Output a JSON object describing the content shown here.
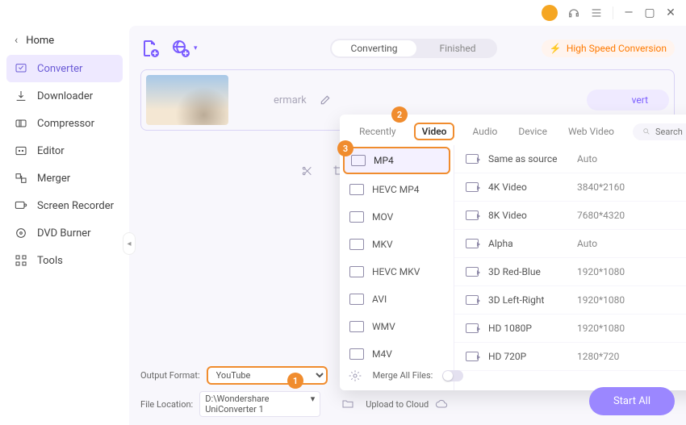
{
  "titlebar": {
    "icons": [
      "avatar",
      "headset",
      "menu",
      "min",
      "max",
      "close"
    ]
  },
  "sidebar": {
    "home": "Home",
    "items": [
      {
        "label": "Converter",
        "icon": "converter-icon",
        "active": true
      },
      {
        "label": "Downloader",
        "icon": "download-icon"
      },
      {
        "label": "Compressor",
        "icon": "compress-icon"
      },
      {
        "label": "Editor",
        "icon": "editor-icon"
      },
      {
        "label": "Merger",
        "icon": "merger-icon"
      },
      {
        "label": "Screen Recorder",
        "icon": "record-icon"
      },
      {
        "label": "DVD Burner",
        "icon": "dvd-icon"
      },
      {
        "label": "Tools",
        "icon": "tools-icon"
      }
    ]
  },
  "main": {
    "tabs": [
      "Converting",
      "Finished"
    ],
    "activeTab": 0,
    "hsLabel": "High Speed Conversion",
    "card": {
      "ermark": "ermark",
      "convert": "vert"
    },
    "search_placeholder": "Search"
  },
  "popup": {
    "tabs": [
      "Recently",
      "Video",
      "Audio",
      "Device",
      "Web Video"
    ],
    "activeTab": 1,
    "formats": [
      "MP4",
      "HEVC MP4",
      "MOV",
      "MKV",
      "HEVC MKV",
      "AVI",
      "WMV",
      "M4V"
    ],
    "activeFormat": 0,
    "resolutions": [
      {
        "name": "Same as source",
        "val": "Auto"
      },
      {
        "name": "4K Video",
        "val": "3840*2160"
      },
      {
        "name": "8K Video",
        "val": "7680*4320"
      },
      {
        "name": "Alpha",
        "val": "Auto"
      },
      {
        "name": "3D Red-Blue",
        "val": "1920*1080"
      },
      {
        "name": "3D Left-Right",
        "val": "1920*1080"
      },
      {
        "name": "HD 1080P",
        "val": "1920*1080"
      },
      {
        "name": "HD 720P",
        "val": "1280*720"
      }
    ]
  },
  "bottom": {
    "outputLabel": "Output Format:",
    "outputValue": "YouTube",
    "fileLabel": "File Location:",
    "fileValue": "D:\\Wondershare UniConverter 1",
    "mergeLabel": "Merge All Files:",
    "uploadLabel": "Upload to Cloud",
    "startAll": "Start All"
  },
  "callouts": {
    "1": "1",
    "2": "2",
    "3": "3"
  }
}
